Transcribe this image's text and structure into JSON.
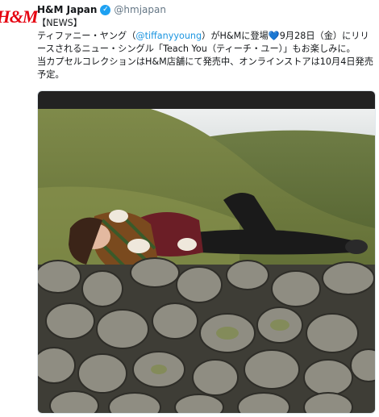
{
  "account": {
    "logo_text": "H&M",
    "display_name": "H&M Japan",
    "handle": "@hmjapan",
    "verified_icon": "verified-badge-icon",
    "brand_color": "#e50010",
    "verified_color": "#1da1f2",
    "mention_color": "#1b95e0"
  },
  "tweet": {
    "line1": "【NEWS】",
    "p1": "ティファニー・ヤング（",
    "mention": "@tiffanyyoung",
    "p2": "）がH&Mに登場",
    "heart": "💙",
    "p3": "9月28日（金）にリリースされるニュー・シングル「Teach You（ティーチ・ユー）」もお楽しみに。",
    "p4": "当カプセルコレクションはH&M店舗にて発売中、オンラインストアは10月4日発売予定。"
  },
  "media": {
    "icon": "photo-woman-on-stone-wall"
  }
}
